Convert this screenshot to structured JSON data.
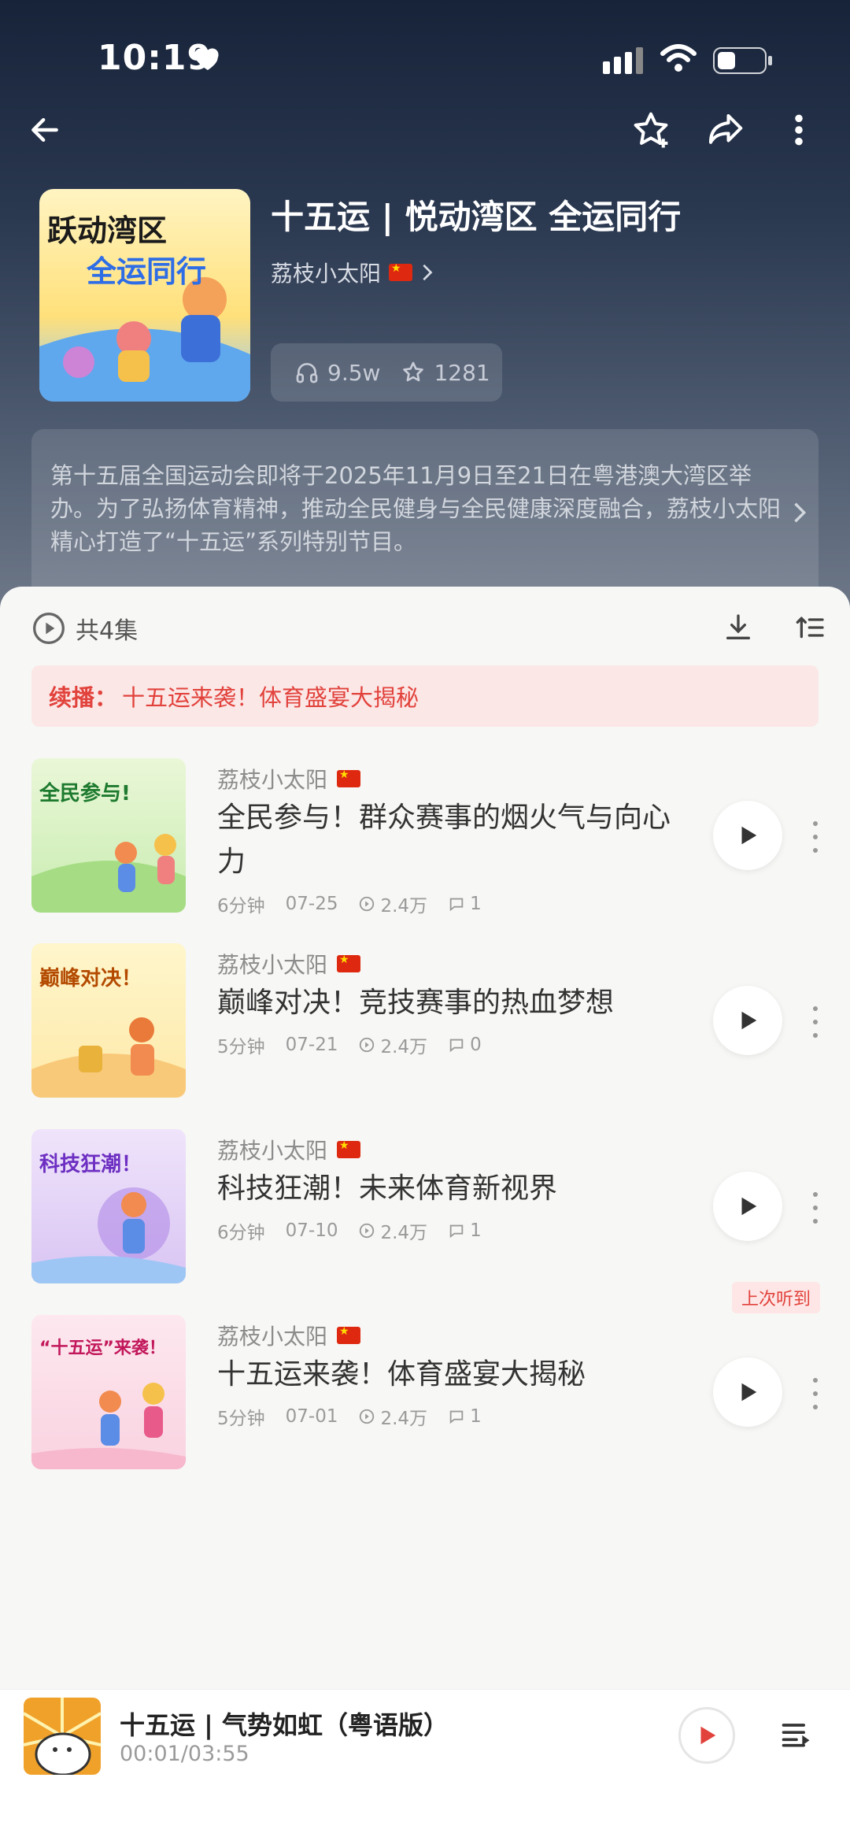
{
  "status_bar": {
    "time": "10:19"
  },
  "album": {
    "title": "十五运 | 悦动湾区 全运同行",
    "author": "荔枝小太阳",
    "plays": "9.5w",
    "favorites": "1281",
    "cover_text_line1": "跃动湾区",
    "cover_text_line2": "全运同行",
    "description": "第十五届全国运动会即将于2025年11月9日至21日在粤港澳大湾区举办。为了弘扬体育精神，推动全民健身与全民健康深度融合，荔枝小太阳精心打造了“十五运”系列特别节目。"
  },
  "list": {
    "count_label": "共4集",
    "resume_key": "续播：",
    "resume_value": "十五运来袭！体育盛宴大揭秘"
  },
  "episodes": [
    {
      "author": "荔枝小太阳",
      "title": "全民参与！群众赛事的烟火气与向心力",
      "duration": "6分钟",
      "date": "07-25",
      "plays": "2.4万",
      "comments": "1",
      "thumb_text": "全民参与!",
      "thumb_color": "#c8ecb0"
    },
    {
      "author": "荔枝小太阳",
      "title": "巅峰对决！竞技赛事的热血梦想",
      "duration": "5分钟",
      "date": "07-21",
      "plays": "2.4万",
      "comments": "0",
      "thumb_text": "巅峰对决！",
      "thumb_color": "#fde9a8"
    },
    {
      "author": "荔枝小太阳",
      "title": "科技狂潮！未来体育新视界",
      "duration": "6分钟",
      "date": "07-10",
      "plays": "2.4万",
      "comments": "1",
      "thumb_text": "科技狂潮！",
      "thumb_color": "#d9c4f3"
    },
    {
      "author": "荔枝小太阳",
      "title": "十五运来袭！体育盛宴大揭秘",
      "duration": "5分钟",
      "date": "07-01",
      "plays": "2.4万",
      "comments": "1",
      "thumb_text": "“十五运”来袭！",
      "thumb_color": "#f9d2e0",
      "badge": "上次听到"
    }
  ],
  "player": {
    "title": "十五运 | 气势如虹（粤语版）",
    "time": "00:01/03:55"
  },
  "colors": {
    "accent": "#e2423c",
    "hero_top": "#172339"
  }
}
